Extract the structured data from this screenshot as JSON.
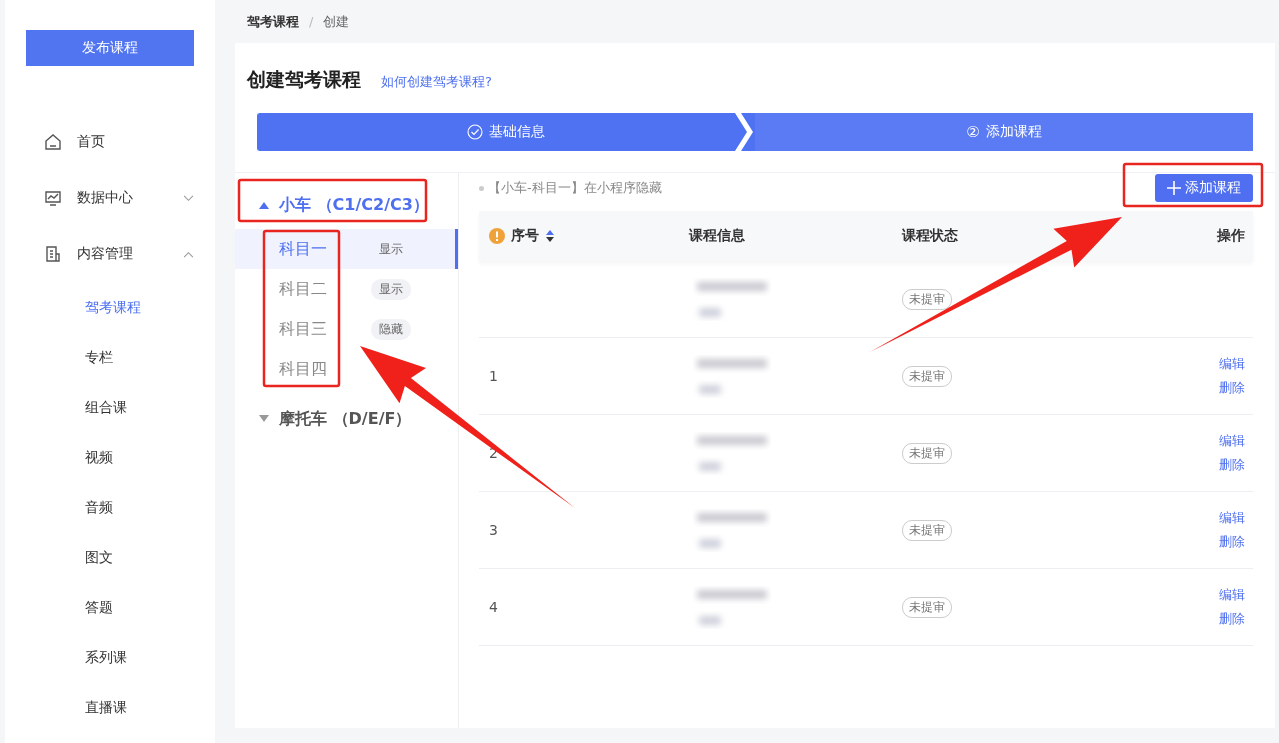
{
  "sidebar": {
    "publish_button": "发布课程",
    "items": [
      {
        "label": "首页"
      },
      {
        "label": "数据中心",
        "expanded": false
      },
      {
        "label": "内容管理",
        "expanded": true,
        "children": [
          {
            "label": "驾考课程",
            "selected": true
          },
          {
            "label": "专栏",
            "selected": false
          },
          {
            "label": "组合课",
            "selected": false
          },
          {
            "label": "视频",
            "selected": false
          },
          {
            "label": "音频",
            "selected": false
          },
          {
            "label": "图文",
            "selected": false
          },
          {
            "label": "答题",
            "selected": false
          },
          {
            "label": "系列课",
            "selected": false
          },
          {
            "label": "直播课",
            "selected": false
          }
        ]
      }
    ]
  },
  "breadcrumb": [
    "驾考课程",
    "/",
    "创建"
  ],
  "page_title": "创建驾考课程",
  "help_link": "如何创建驾考课程?",
  "steps": [
    {
      "label": "基础信息",
      "done": true
    },
    {
      "label": "添加课程",
      "number": "②",
      "done": false
    }
  ],
  "categories": [
    {
      "label": "小车 （C1/C2/C3）",
      "expanded": true,
      "subjects": [
        {
          "label": "科目一",
          "tag": "显示",
          "selected": true
        },
        {
          "label": "科目二",
          "tag": "显示",
          "selected": false
        },
        {
          "label": "科目三",
          "tag": "隐藏",
          "selected": false
        },
        {
          "label": "科目四",
          "selected": false
        }
      ]
    },
    {
      "label": "摩托车 （D/E/F）",
      "expanded": false
    }
  ],
  "notice": "【小车-科目一】在小程序隐藏",
  "add_button": "添加课程",
  "table": {
    "columns": [
      "序号",
      "课程信息",
      "课程状态",
      "操作"
    ],
    "rows": [
      {
        "status": "未提审"
      },
      {
        "index": "1",
        "status": "未提审",
        "actions": [
          "编辑",
          "删除"
        ]
      },
      {
        "index": "2",
        "status": "未提审",
        "actions": [
          "编辑",
          "删除"
        ]
      },
      {
        "index": "3",
        "status": "未提审",
        "actions": [
          "编辑",
          "删除"
        ]
      },
      {
        "index": "4",
        "status": "未提审",
        "actions": [
          "编辑",
          "删除"
        ]
      }
    ]
  }
}
